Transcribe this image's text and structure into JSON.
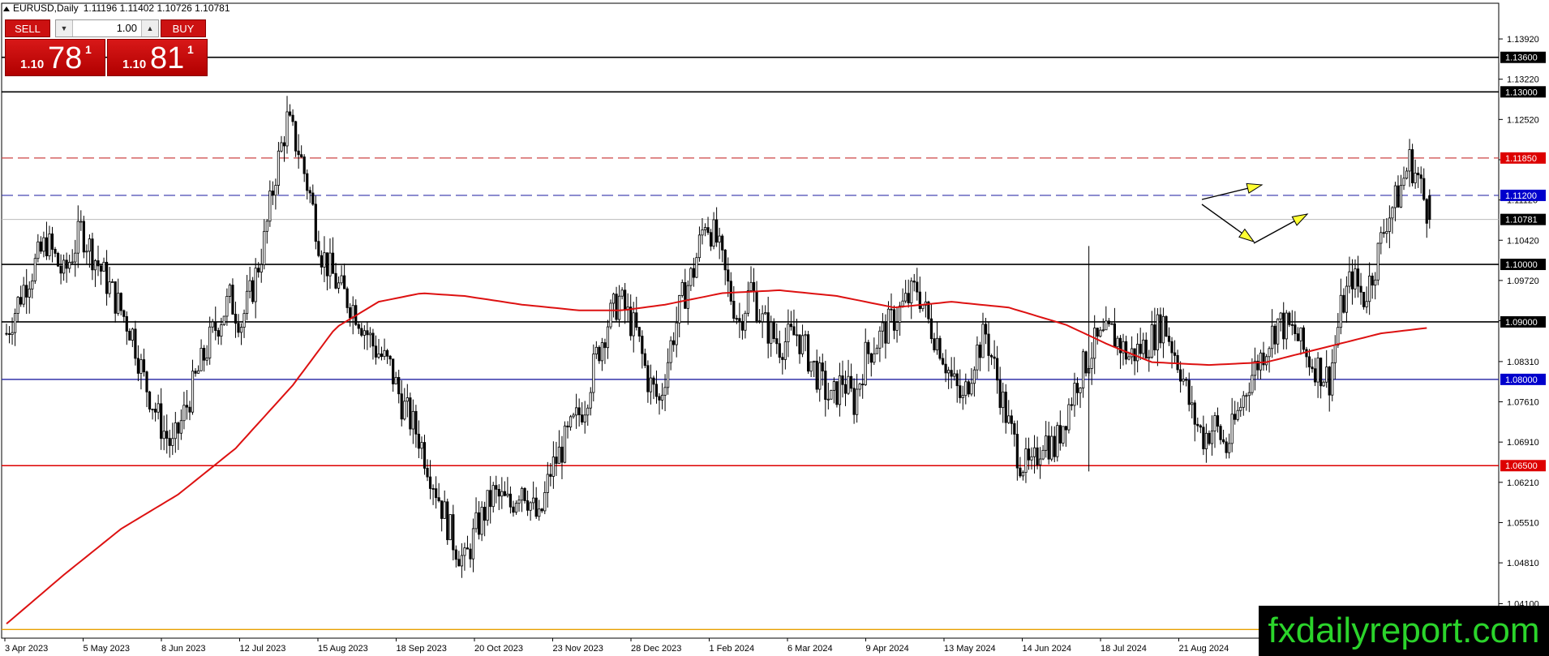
{
  "header": {
    "symbol": "EURUSD,Daily",
    "ohlc": "1.11196 1.11402 1.10726 1.10781"
  },
  "trade_panel": {
    "sell_label": "SELL",
    "buy_label": "BUY",
    "lot_value": "1.00",
    "sell_price_small": "1.10",
    "sell_price_big": "78",
    "sell_price_sup": "1",
    "buy_price_small": "1.10",
    "buy_price_big": "81",
    "buy_price_sup": "1"
  },
  "watermark": "fxdailyreport.com",
  "colors": {
    "candle": "#000000",
    "ma": "#dd1111",
    "resistance_red": "#cc4444",
    "blue_dash": "#3333aa",
    "support_red": "#dd0000",
    "orange": "#e8a000",
    "arrow_fill": "#ffff33"
  },
  "chart_data": {
    "type": "candlestick",
    "symbol": "EURUSD",
    "timeframe": "Daily",
    "ylim": [
      1.035,
      1.144
    ],
    "y_ticks": [
      "1.13920",
      "1.13220",
      "1.12520",
      "1.11820",
      "1.11120",
      "1.10420",
      "1.09720",
      "1.09020",
      "1.08310",
      "1.07610",
      "1.06910",
      "1.06210",
      "1.05510",
      "1.04810",
      "1.04100"
    ],
    "x_ticks": [
      "3 Apr 2023",
      "5 May 2023",
      "8 Jun 2023",
      "12 Jul 2023",
      "15 Aug 2023",
      "18 Sep 2023",
      "20 Oct 2023",
      "23 Nov 2023",
      "28 Dec 2023",
      "1 Feb 2024",
      "6 Mar 2024",
      "9 Apr 2024",
      "13 May 2024",
      "14 Jun 2024",
      "18 Jul 2024",
      "21 Aug 2024"
    ],
    "levels": [
      {
        "price": 1.136,
        "label": "1.13600",
        "style": "solid",
        "color": "#000000",
        "label_bg": "#000000"
      },
      {
        "price": 1.13,
        "label": "1.13000",
        "style": "solid",
        "color": "#000000",
        "label_bg": "#000000"
      },
      {
        "price": 1.1185,
        "label": "1.11850",
        "style": "dashed",
        "color": "#cc4444",
        "label_bg": "#dd0000"
      },
      {
        "price": 1.112,
        "label": "1.11200",
        "style": "dashed",
        "color": "#3333aa",
        "label_bg": "#0000cc"
      },
      {
        "price": 1.10781,
        "label": "1.10781",
        "style": "thin",
        "color": "#bbbbbb",
        "label_bg": "#000000"
      },
      {
        "price": 1.1,
        "label": "1.10000",
        "style": "solid",
        "color": "#000000",
        "label_bg": "#000000"
      },
      {
        "price": 1.09,
        "label": "1.09000",
        "style": "solid",
        "color": "#000000",
        "label_bg": "#000000"
      },
      {
        "price": 1.08,
        "label": "1.08000",
        "style": "solid",
        "color": "#3333aa",
        "label_bg": "#0000cc"
      },
      {
        "price": 1.065,
        "label": "1.06500",
        "style": "solid",
        "color": "#dd0000",
        "label_bg": "#dd0000"
      },
      {
        "price": 1.0365,
        "label": "",
        "style": "solid",
        "color": "#e8a000",
        "label_bg": ""
      }
    ],
    "price_path": [
      [
        0,
        1.088
      ],
      [
        6,
        1.096
      ],
      [
        14,
        1.104
      ],
      [
        20,
        1.098
      ],
      [
        26,
        1.106
      ],
      [
        32,
        1.1
      ],
      [
        38,
        1.094
      ],
      [
        44,
        1.088
      ],
      [
        48,
        1.08
      ],
      [
        54,
        1.072
      ],
      [
        58,
        1.068
      ],
      [
        62,
        1.074
      ],
      [
        66,
        1.08
      ],
      [
        72,
        1.088
      ],
      [
        78,
        1.094
      ],
      [
        82,
        1.09
      ],
      [
        86,
        1.096
      ],
      [
        90,
        1.104
      ],
      [
        94,
        1.116
      ],
      [
        98,
        1.125
      ],
      [
        102,
        1.12
      ],
      [
        106,
        1.112
      ],
      [
        110,
        1.102
      ],
      [
        116,
        1.096
      ],
      [
        122,
        1.092
      ],
      [
        128,
        1.086
      ],
      [
        134,
        1.082
      ],
      [
        138,
        1.076
      ],
      [
        144,
        1.07
      ],
      [
        148,
        1.064
      ],
      [
        152,
        1.058
      ],
      [
        156,
        1.052
      ],
      [
        160,
        1.048
      ],
      [
        164,
        1.054
      ],
      [
        170,
        1.06
      ],
      [
        176,
        1.058
      ],
      [
        180,
        1.062
      ],
      [
        186,
        1.055
      ],
      [
        190,
        1.064
      ],
      [
        196,
        1.07
      ],
      [
        202,
        1.076
      ],
      [
        206,
        1.084
      ],
      [
        210,
        1.09
      ],
      [
        214,
        1.094
      ],
      [
        220,
        1.088
      ],
      [
        224,
        1.08
      ],
      [
        228,
        1.076
      ],
      [
        232,
        1.086
      ],
      [
        236,
        1.094
      ],
      [
        240,
        1.099
      ],
      [
        244,
        1.108
      ],
      [
        248,
        1.104
      ],
      [
        252,
        1.096
      ],
      [
        256,
        1.09
      ],
      [
        260,
        1.096
      ],
      [
        264,
        1.09
      ],
      [
        270,
        1.086
      ],
      [
        276,
        1.088
      ],
      [
        282,
        1.082
      ],
      [
        288,
        1.076
      ],
      [
        292,
        1.08
      ],
      [
        296,
        1.076
      ],
      [
        300,
        1.084
      ],
      [
        306,
        1.088
      ],
      [
        312,
        1.092
      ],
      [
        318,
        1.096
      ],
      [
        322,
        1.09
      ],
      [
        326,
        1.086
      ],
      [
        330,
        1.08
      ],
      [
        334,
        1.076
      ],
      [
        338,
        1.084
      ],
      [
        342,
        1.088
      ],
      [
        346,
        1.08
      ],
      [
        350,
        1.072
      ],
      [
        354,
        1.066
      ],
      [
        358,
        1.064
      ],
      [
        362,
        1.07
      ],
      [
        366,
        1.068
      ],
      [
        370,
        1.074
      ],
      [
        374,
        1.08
      ],
      [
        380,
        1.086
      ],
      [
        386,
        1.088
      ],
      [
        392,
        1.084
      ],
      [
        398,
        1.086
      ],
      [
        404,
        1.09
      ],
      [
        410,
        1.082
      ],
      [
        414,
        1.074
      ],
      [
        418,
        1.07
      ],
      [
        422,
        1.072
      ],
      [
        426,
        1.068
      ],
      [
        430,
        1.074
      ],
      [
        434,
        1.08
      ],
      [
        438,
        1.084
      ],
      [
        444,
        1.09
      ],
      [
        450,
        1.088
      ],
      [
        454,
        1.084
      ],
      [
        458,
        1.082
      ],
      [
        462,
        1.08
      ],
      [
        466,
        1.092
      ],
      [
        470,
        1.098
      ],
      [
        474,
        1.094
      ],
      [
        478,
        1.1
      ],
      [
        482,
        1.108
      ],
      [
        486,
        1.112
      ],
      [
        490,
        1.118
      ],
      [
        493,
        1.115
      ],
      [
        497,
        1.1078
      ]
    ],
    "spike": [
      378,
      1.064,
      1.1032
    ],
    "ma_path": [
      [
        0,
        1.0375
      ],
      [
        20,
        1.046
      ],
      [
        40,
        1.054
      ],
      [
        60,
        1.06
      ],
      [
        80,
        1.068
      ],
      [
        100,
        1.079
      ],
      [
        115,
        1.089
      ],
      [
        130,
        1.0935
      ],
      [
        145,
        1.095
      ],
      [
        160,
        1.0945
      ],
      [
        180,
        1.093
      ],
      [
        200,
        1.092
      ],
      [
        215,
        1.092
      ],
      [
        230,
        1.093
      ],
      [
        250,
        1.095
      ],
      [
        270,
        1.0955
      ],
      [
        290,
        1.0945
      ],
      [
        310,
        1.0925
      ],
      [
        330,
        1.0935
      ],
      [
        350,
        1.0925
      ],
      [
        370,
        1.0895
      ],
      [
        385,
        1.086
      ],
      [
        400,
        1.083
      ],
      [
        420,
        1.0825
      ],
      [
        440,
        1.083
      ],
      [
        460,
        1.0855
      ],
      [
        480,
        1.088
      ],
      [
        497,
        1.089
      ]
    ]
  }
}
